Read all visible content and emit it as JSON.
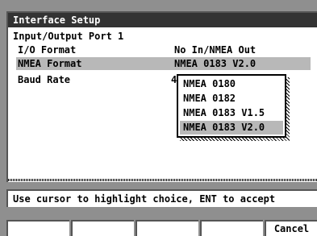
{
  "window": {
    "title": "Interface Setup"
  },
  "section": {
    "label": "Input/Output Port 1"
  },
  "fields": [
    {
      "label": "I/O Format",
      "value": "No In/NMEA Out"
    },
    {
      "label": "NMEA Format",
      "value": "NMEA 0183 V2.0"
    },
    {
      "label": "Baud Rate",
      "value": "4"
    }
  ],
  "dropdown": {
    "options": [
      "NMEA 0180",
      "NMEA 0182",
      "NMEA 0183 V1.5",
      "NMEA 0183 V2.0"
    ],
    "selected_index": 3
  },
  "hint": {
    "text": "Use cursor to highlight choice, ENT to accept"
  },
  "softkeys": [
    "",
    "",
    "",
    "",
    "Cancel"
  ],
  "colors": {
    "highlight": "#b8b8b8",
    "title_bg": "#333333",
    "frame": "#8f8f8f"
  }
}
